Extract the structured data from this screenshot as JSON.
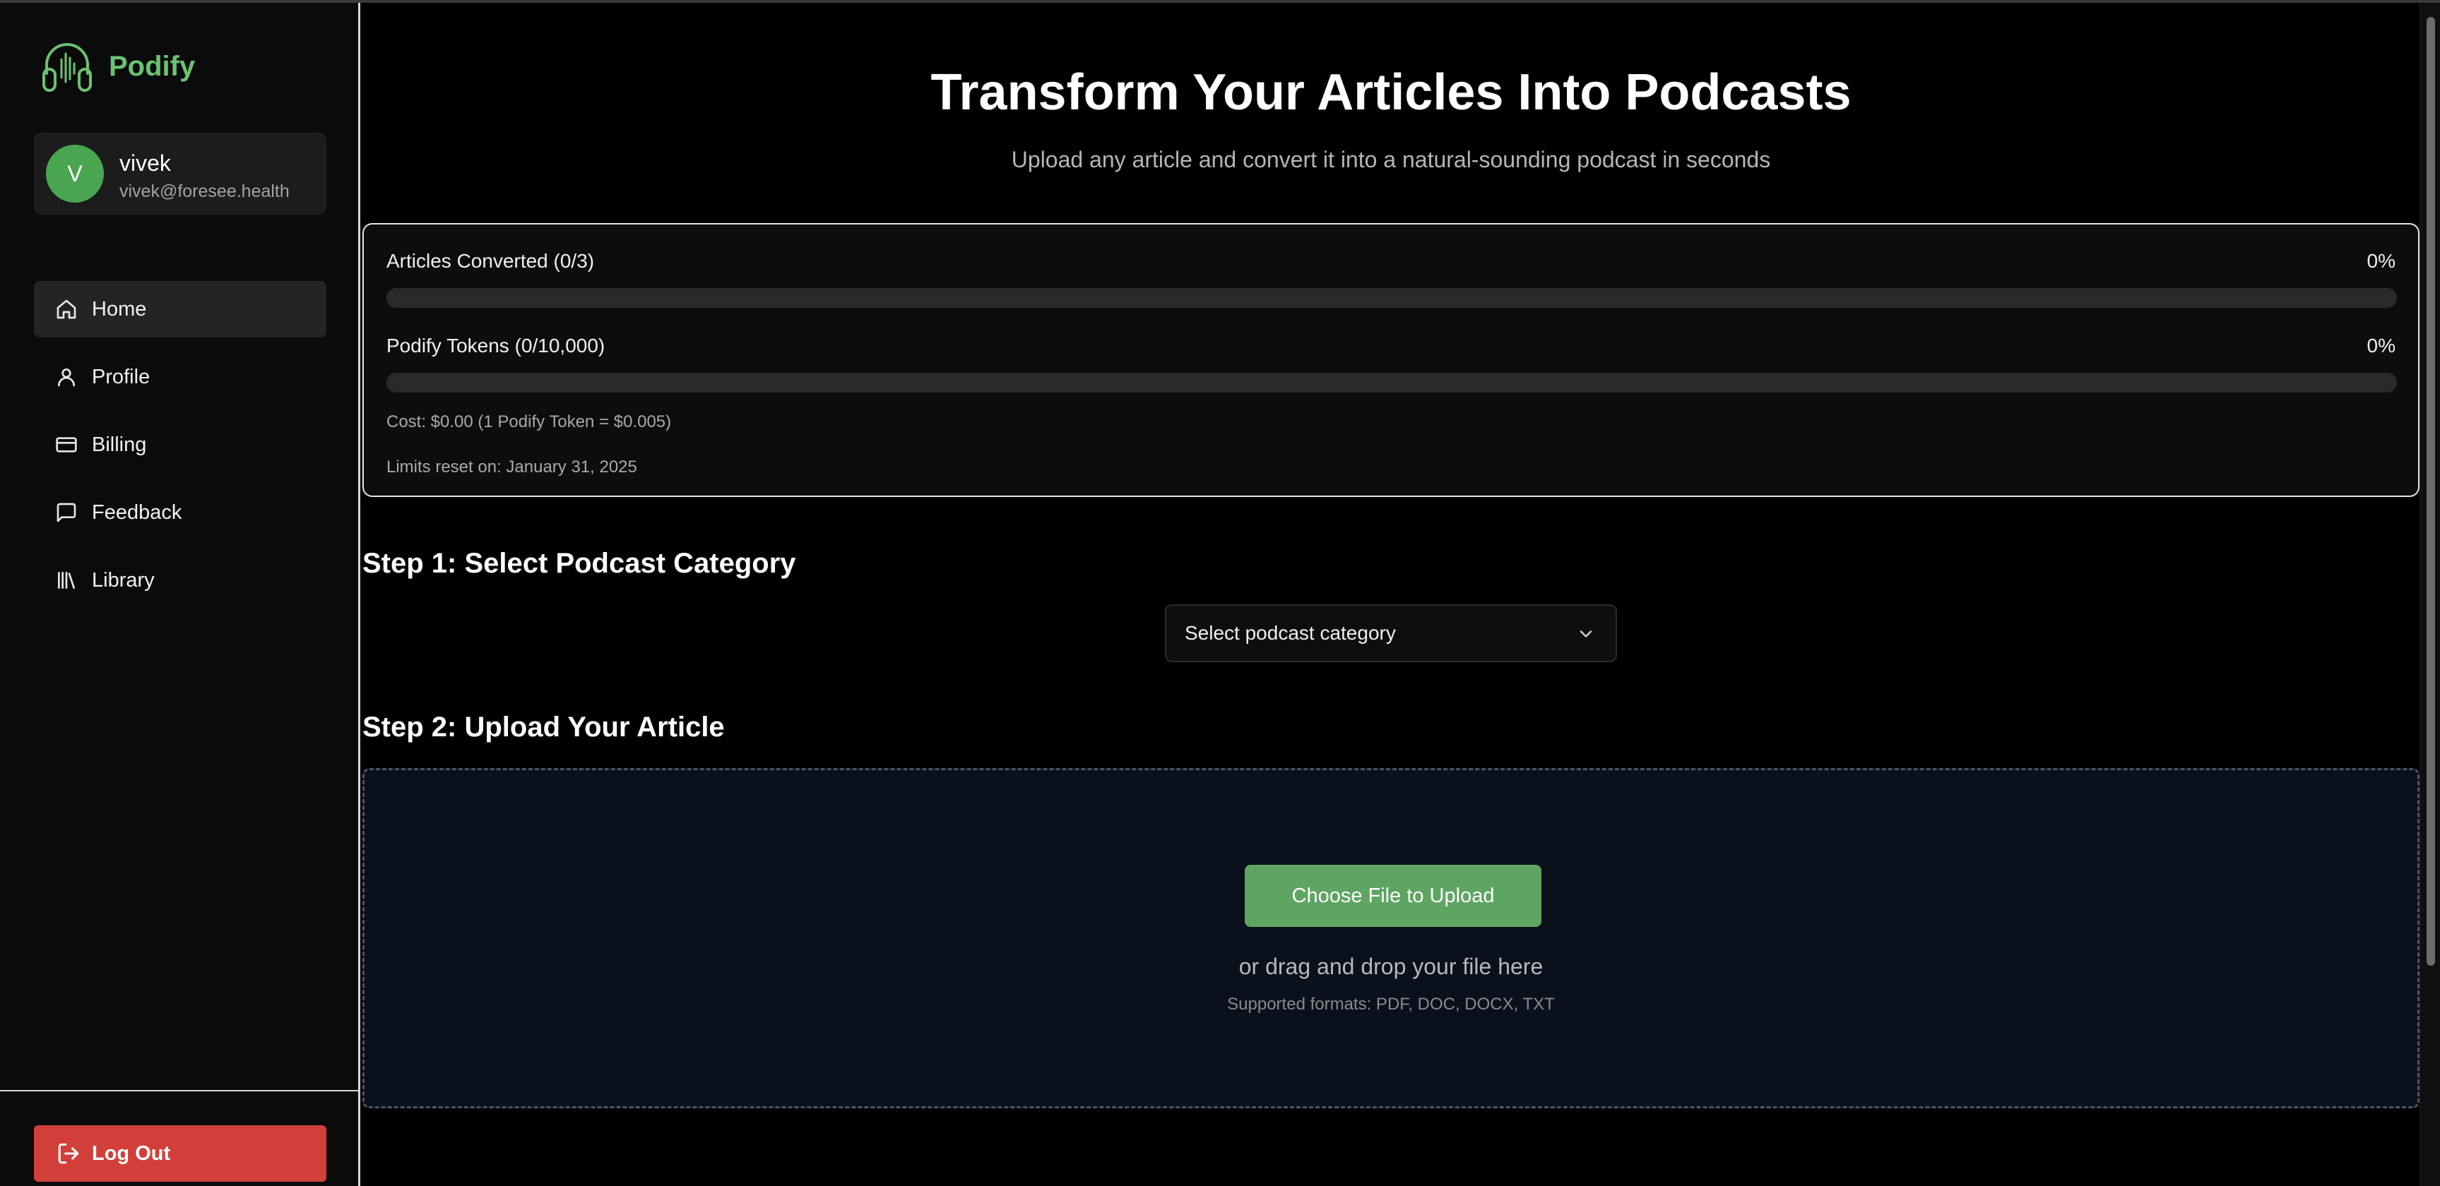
{
  "app": {
    "name": "Podify",
    "brand_color": "#6ac271"
  },
  "user": {
    "initial": "V",
    "name": "vivek",
    "email": "vivek@foresee.health"
  },
  "sidebar": {
    "items": [
      {
        "label": "Home",
        "icon": "home-icon",
        "active": true
      },
      {
        "label": "Profile",
        "icon": "user-icon",
        "active": false
      },
      {
        "label": "Billing",
        "icon": "credit-card-icon",
        "active": false
      },
      {
        "label": "Feedback",
        "icon": "message-square-icon",
        "active": false
      },
      {
        "label": "Library",
        "icon": "library-icon",
        "active": false
      }
    ],
    "logout_label": "Log Out",
    "logout_color": "#d23f3a"
  },
  "hero": {
    "title": "Transform Your Articles Into Podcasts",
    "subtitle": "Upload any article and convert it into a natural-sounding podcast in seconds"
  },
  "usage": {
    "articles_label": "Articles Converted (0/3)",
    "articles_pct": "0%",
    "articles_progress": 0,
    "tokens_label": "Podify Tokens (0/10,000)",
    "tokens_pct": "0%",
    "tokens_progress": 0,
    "cost_note": "Cost: $0.00 (1 Podify Token = $0.005)",
    "reset_note": "Limits reset on: January 31, 2025"
  },
  "step1": {
    "title": "Step 1: Select Podcast Category",
    "select_value": "Select podcast category"
  },
  "step2": {
    "title": "Step 2: Upload Your Article",
    "upload_label": "Choose File to Upload",
    "drop_text": "or drag and drop your file here",
    "formats": "Supported formats: PDF, DOC, DOCX, TXT"
  }
}
